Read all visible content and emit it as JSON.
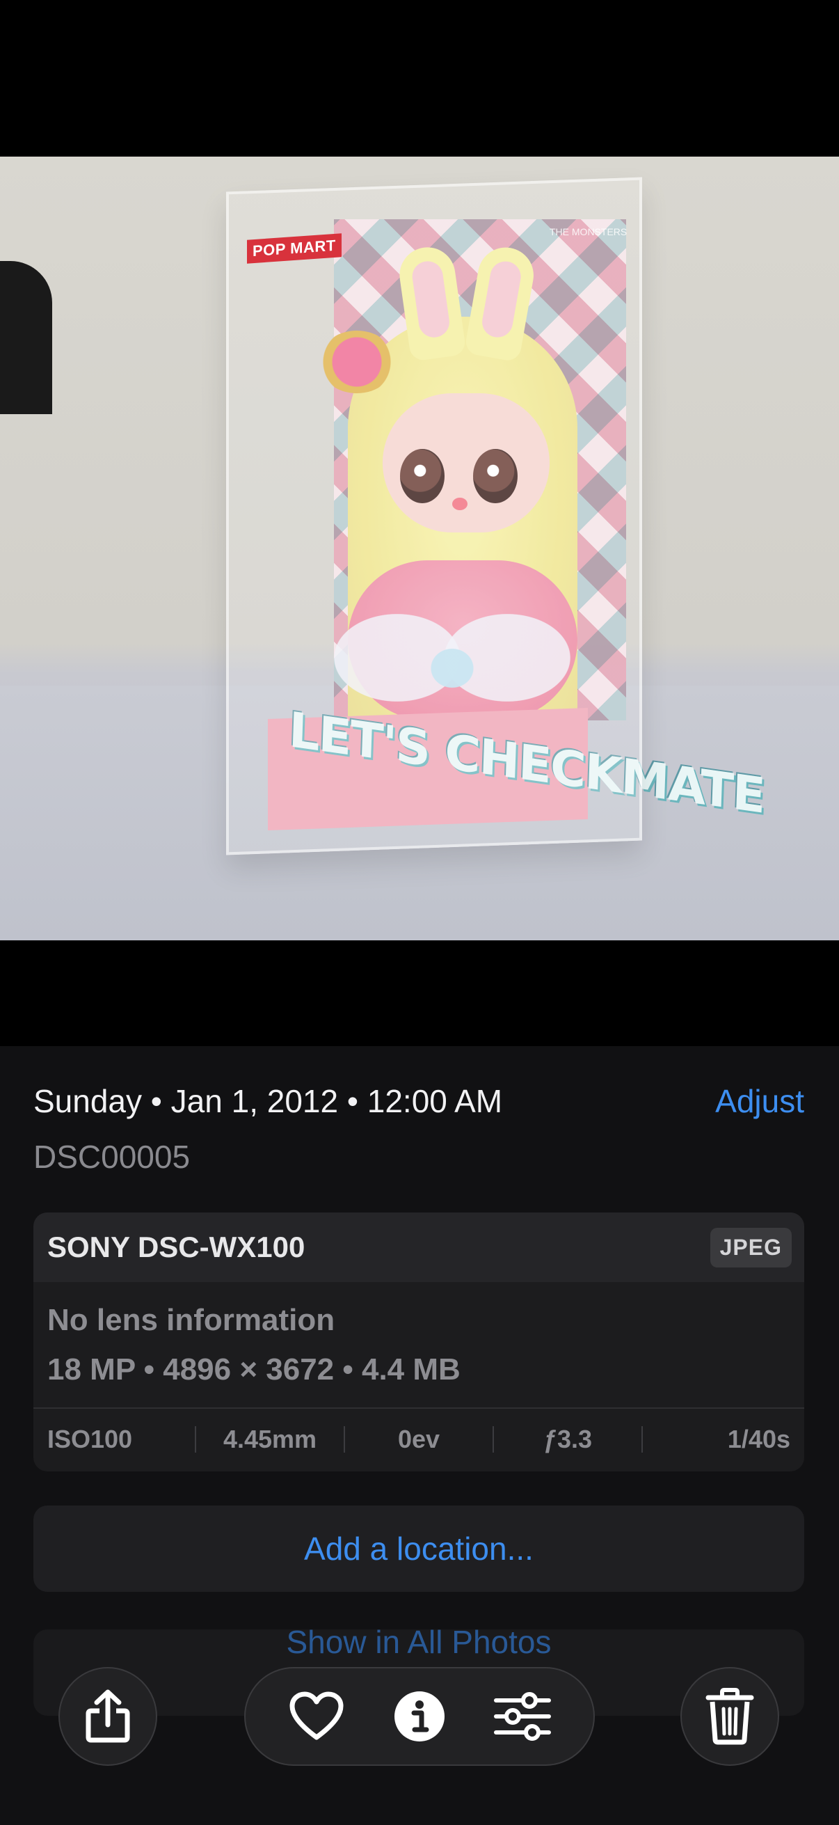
{
  "photo": {
    "brand_tag": "POP MART",
    "brand_logo": "THE MONSTERS",
    "pedestal_text": "LET'S CHECKMATE"
  },
  "info": {
    "date_line": "Sunday • Jan 1, 2012 • 12:00 AM",
    "adjust_label": "Adjust",
    "filename": "DSC00005"
  },
  "metadata": {
    "camera": "SONY DSC-WX100",
    "format": "JPEG",
    "lens": "No lens information",
    "specs": "18 MP • 4896 × 3672 • 4.4 MB",
    "exif": {
      "iso": "ISO100",
      "focal_length": "4.45mm",
      "exposure_comp": "0ev",
      "aperture": "ƒ3.3",
      "shutter": "1/40s"
    }
  },
  "actions": {
    "add_location": "Add a location...",
    "show_in_all_photos": "Show in All Photos"
  },
  "toolbar": {
    "icons": [
      "share-icon",
      "heart-icon",
      "info-icon",
      "adjust-sliders-icon",
      "trash-icon"
    ]
  }
}
